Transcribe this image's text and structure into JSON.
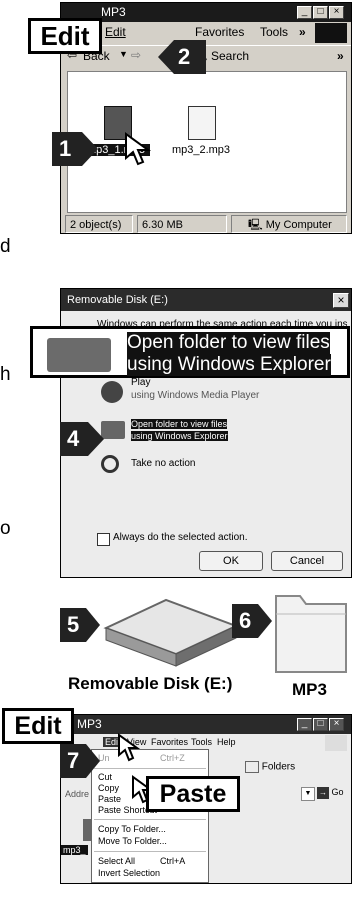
{
  "panel1": {
    "window_title": "MP3",
    "menu": {
      "edit": "Edit",
      "favorites": "Favorites",
      "tools": "Tools",
      "more": "»"
    },
    "toolbar": {
      "back": "Back",
      "search": "Search",
      "more": "»"
    },
    "files": [
      {
        "name": "mp3_1.mp3"
      },
      {
        "name": "mp3_2.mp3"
      }
    ],
    "status": {
      "objects": "2 object(s)",
      "size": "6.30 MB",
      "location": "My Computer"
    },
    "callout_edit": "Edit",
    "step1": "1",
    "step2": "2"
  },
  "side_text": {
    "a": "d",
    "b": "h",
    "c": "o"
  },
  "panel2": {
    "dialog_title": "Removable Disk (E:)",
    "intro": "Windows can perform the same action each time you insert",
    "zoom_line1": "Open folder to view files",
    "zoom_line2": "using Windows Explorer",
    "opt_play_1": "Play",
    "opt_play_2": "using Windows Media Player",
    "opt_open_1": "Open folder to view files",
    "opt_open_2": "using Windows Explorer",
    "opt_none": "Take no action",
    "checkbox_label": "Always do the selected action.",
    "ok": "OK",
    "cancel": "Cancel",
    "step4": "4"
  },
  "panel3": {
    "step5": "5",
    "step6": "6",
    "disk_label": "Removable Disk (E:)",
    "folder_label": "MP3"
  },
  "panel4": {
    "window_title": "MP3",
    "menu": {
      "edit": "Edit",
      "view": "View",
      "favorites": "Favorites",
      "tools": "Tools",
      "help": "Help"
    },
    "toolbar": {
      "folders": "Folders",
      "address_label": "Addre",
      "go": "Go"
    },
    "partial_file": "mp3_",
    "callout_edit": "Edit",
    "callout_paste": "Paste",
    "step7": "7",
    "context_menu": [
      {
        "label": "Un",
        "shortcut": "Ctrl+Z"
      },
      {
        "label": "Cut",
        "shortcut": ""
      },
      {
        "label": "Copy",
        "shortcut": ""
      },
      {
        "label": "Paste",
        "shortcut": ""
      },
      {
        "label": "Paste Shortcut",
        "shortcut": ""
      },
      {
        "label": "Copy To Folder...",
        "shortcut": ""
      },
      {
        "label": "Move To Folder...",
        "shortcut": ""
      },
      {
        "label": "Select All",
        "shortcut": "Ctrl+A"
      },
      {
        "label": "Invert Selection",
        "shortcut": ""
      }
    ]
  }
}
